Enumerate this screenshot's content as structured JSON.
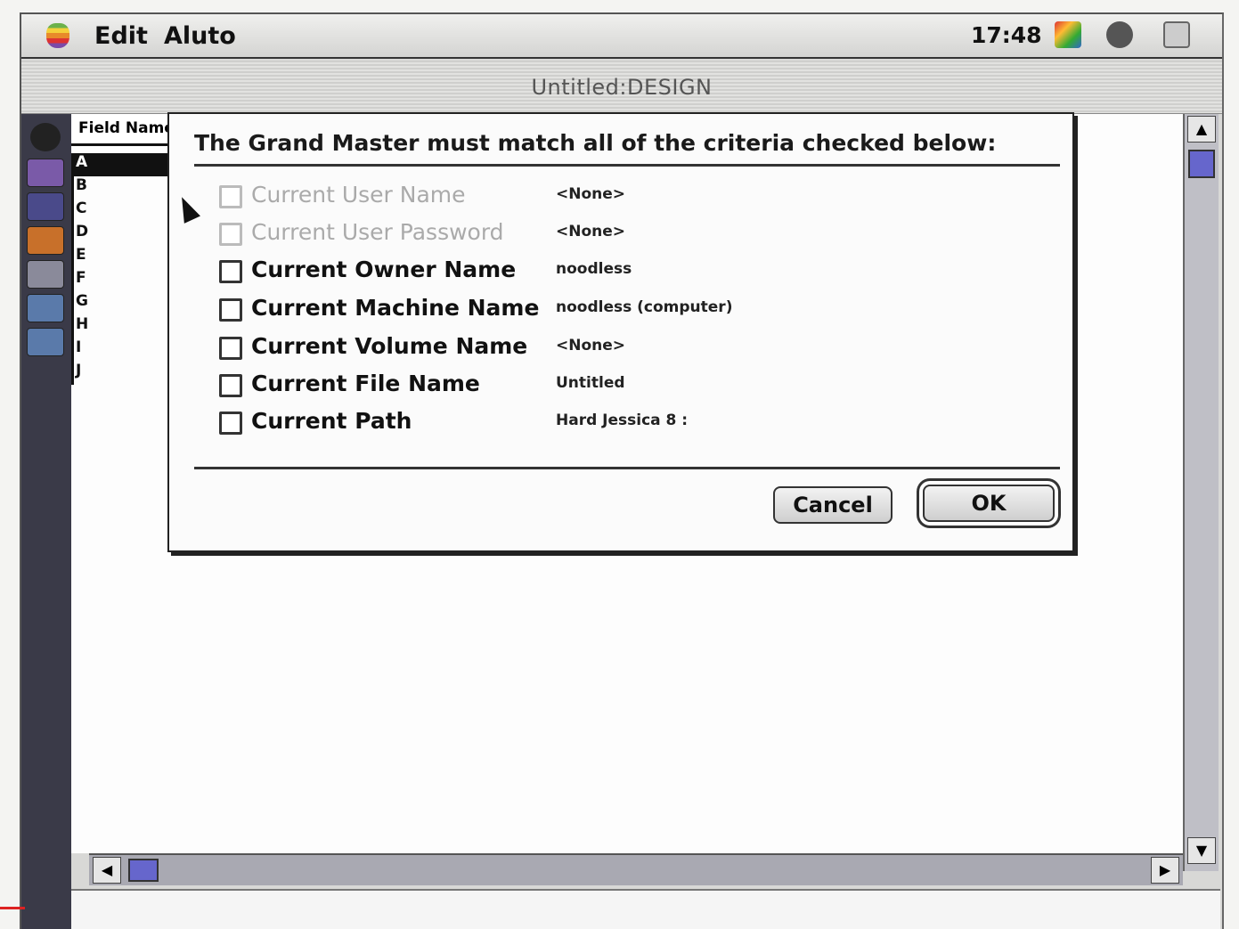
{
  "menubar": {
    "items": [
      "Edit",
      "Aluto"
    ],
    "clock": "17:48"
  },
  "window": {
    "title": "Untitled:DESIGN"
  },
  "sidebar": {
    "header": "Field Name",
    "rows": [
      "A",
      "B",
      "C",
      "D",
      "E",
      "F",
      "G",
      "H",
      "I",
      "J"
    ]
  },
  "dialog": {
    "title": "The Grand Master must match all of the criteria checked below:",
    "criteria": [
      {
        "label": "Current User Name",
        "value": "<None>",
        "enabled": false,
        "checked": false
      },
      {
        "label": "Current User Password",
        "value": "<None>",
        "enabled": false,
        "checked": false
      },
      {
        "label": "Current Owner Name",
        "value": "noodless",
        "enabled": true,
        "checked": false
      },
      {
        "label": "Current Machine Name",
        "value": "noodless (computer)",
        "enabled": true,
        "checked": false
      },
      {
        "label": "Current Volume Name",
        "value": "<None>",
        "enabled": true,
        "checked": false
      },
      {
        "label": "Current File Name",
        "value": "Untitled",
        "enabled": true,
        "checked": false
      },
      {
        "label": "Current Path",
        "value": "Hard Jessica 8 :",
        "enabled": true,
        "checked": false
      }
    ],
    "cancel_label": "Cancel",
    "ok_label": "OK"
  },
  "colors": {
    "scroll_thumb": "#6666cc",
    "toolstrip": "#3a3a48"
  }
}
